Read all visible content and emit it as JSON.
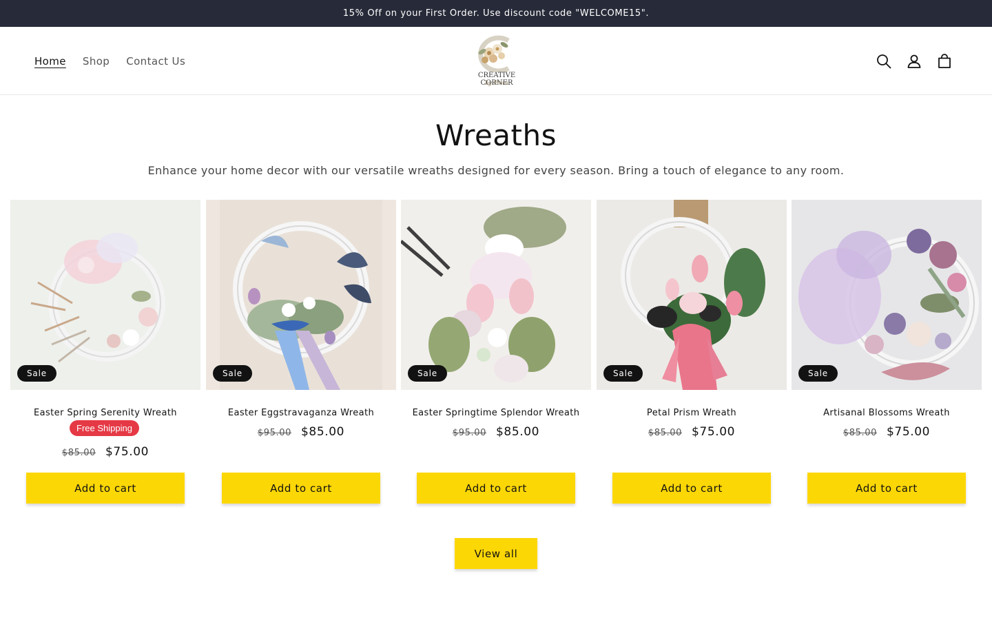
{
  "announcement": "15% Off on your First Order. Use discount code \"WELCOME15\".",
  "nav": {
    "items": [
      {
        "label": "Home",
        "active": true
      },
      {
        "label": "Shop",
        "active": false
      },
      {
        "label": "Contact Us",
        "active": false
      }
    ]
  },
  "logo": {
    "line1": "CREATIVE CORNER",
    "line2": "by Flora"
  },
  "icons": {
    "search": "search-icon",
    "account": "account-icon",
    "cart": "cart-icon"
  },
  "section": {
    "title": "Wreaths",
    "description": "Enhance your home decor with our versatile wreaths designed for every season. Bring a touch of elegance to any room."
  },
  "products": [
    {
      "name": "Easter Spring Serenity Wreath",
      "badge": "Sale",
      "shipping_badge": "Free Shipping",
      "old_price": "$85.00",
      "price": "$75.00",
      "cta": "Add to cart"
    },
    {
      "name": "Easter Eggstravaganza Wreath",
      "badge": "Sale",
      "old_price": "$95.00",
      "price": "$85.00",
      "cta": "Add to cart"
    },
    {
      "name": "Easter Springtime Splendor Wreath",
      "badge": "Sale",
      "old_price": "$95.00",
      "price": "$85.00",
      "cta": "Add to cart"
    },
    {
      "name": "Petal Prism Wreath",
      "badge": "Sale",
      "old_price": "$85.00",
      "price": "$75.00",
      "cta": "Add to cart"
    },
    {
      "name": "Artisanal Blossoms Wreath",
      "badge": "Sale",
      "old_price": "$85.00",
      "price": "$75.00",
      "cta": "Add to cart"
    }
  ],
  "view_all": "View all",
  "colors": {
    "announcement_bg": "#272a38",
    "button_bg": "#fcd706",
    "sale_badge": "#121212",
    "shipping_badge": "#e53945"
  }
}
